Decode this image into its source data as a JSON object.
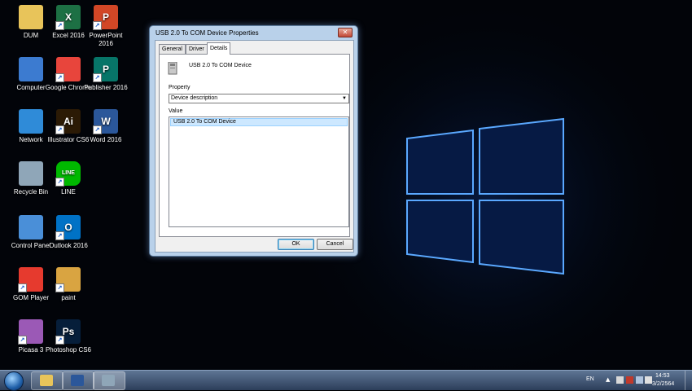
{
  "desktop": {
    "icons": [
      {
        "label": "DUM",
        "glyph": "",
        "color": "#e8c45a",
        "arrow": false
      },
      {
        "label": "Excel 2016",
        "glyph": "X",
        "color": "#1d7044",
        "arrow": true
      },
      {
        "label": "PowerPoint 2016",
        "glyph": "P",
        "color": "#d24726",
        "arrow": true
      },
      {
        "label": "Computer",
        "glyph": "",
        "color": "#3c7bd0",
        "arrow": false
      },
      {
        "label": "Google Chrome",
        "glyph": "",
        "color": "#e8453c",
        "arrow": true
      },
      {
        "label": "Publisher 2016",
        "glyph": "P",
        "color": "#077568",
        "arrow": true
      },
      {
        "label": "Network",
        "glyph": "",
        "color": "#2f8bd8",
        "arrow": false
      },
      {
        "label": "Illustrator CS6",
        "glyph": "Ai",
        "color": "#2b1a05",
        "arrow": true
      },
      {
        "label": "Word 2016",
        "glyph": "W",
        "color": "#2b579a",
        "arrow": true
      },
      {
        "label": "Recycle Bin",
        "glyph": "",
        "color": "#8fa6b8",
        "arrow": false
      },
      {
        "label": "LINE",
        "glyph": "LINE",
        "color": "#00b900",
        "arrow": true
      },
      {
        "label": "Control Panel",
        "glyph": "",
        "color": "#4a8fd8",
        "arrow": false
      },
      {
        "label": "Outlook 2016",
        "glyph": "O",
        "color": "#0072c6",
        "arrow": true
      },
      {
        "label": "GOM Player",
        "glyph": "",
        "color": "#e63a2e",
        "arrow": true
      },
      {
        "label": "paint",
        "glyph": "",
        "color": "#d9a441",
        "arrow": true
      },
      {
        "label": "Picasa 3",
        "glyph": "",
        "color": "#9b59b6",
        "arrow": true
      },
      {
        "label": "Photoshop CS6",
        "glyph": "Ps",
        "color": "#061e3a",
        "arrow": true
      }
    ]
  },
  "dialog": {
    "title": "USB 2.0 To COM Device Properties",
    "close_label": "✕",
    "tabs": [
      "General",
      "Driver",
      "Details"
    ],
    "device_name": "USB 2.0 To COM Device",
    "property_label": "Property",
    "property_value": "Device description",
    "dropdown_glyph": "▼",
    "value_label": "Value",
    "value_item": "USB 2.0 To COM Device",
    "ok_label": "OK",
    "cancel_label": "Cancel"
  },
  "annotation": {
    "arrow_color": "#e8453c"
  },
  "taskbar": {
    "language": "EN",
    "tray_arrow": "▲",
    "time": "14:53",
    "date": "3/2/2564"
  }
}
